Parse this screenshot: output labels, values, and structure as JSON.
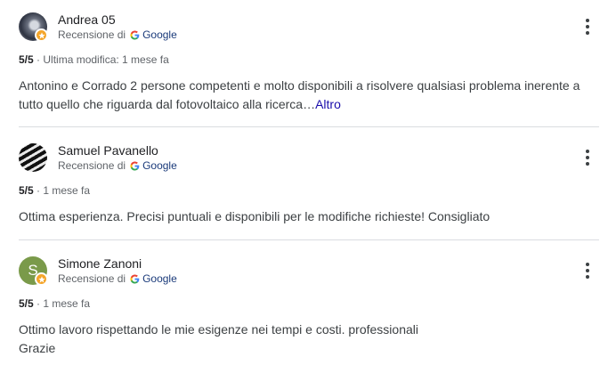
{
  "source_label": "Recensione di",
  "google_label": "Google",
  "reviews": [
    {
      "name": "Andrea 05",
      "rating": "5/5",
      "time": "· Ultima modifica: 1 mese fa",
      "text": "Antonino e Corrado 2 persone competenti e molto disponibili a risolvere qualsiasi problema inerente a tutto quello che riguarda dal fotovoltaico alla ricerca…",
      "more_label": "Altro"
    },
    {
      "name": "Samuel Pavanello",
      "rating": "5/5",
      "time": "· 1 mese fa",
      "text": "Ottima esperienza. Precisi puntuali e disponibili per le modifiche richieste! Consigliato"
    },
    {
      "name": "Simone Zanoni",
      "initial": "S",
      "rating": "5/5",
      "time": "· 1 mese fa",
      "text_line1": "Ottimo lavoro rispettando le mie esigenze nei tempi e costi. professionali",
      "text_line2": "Grazie"
    }
  ],
  "colors": {
    "badge": "#f4a52a",
    "avatar_letter_bg": "#7a9a4a",
    "link": "#1a0dab",
    "divider": "#dadce0"
  }
}
